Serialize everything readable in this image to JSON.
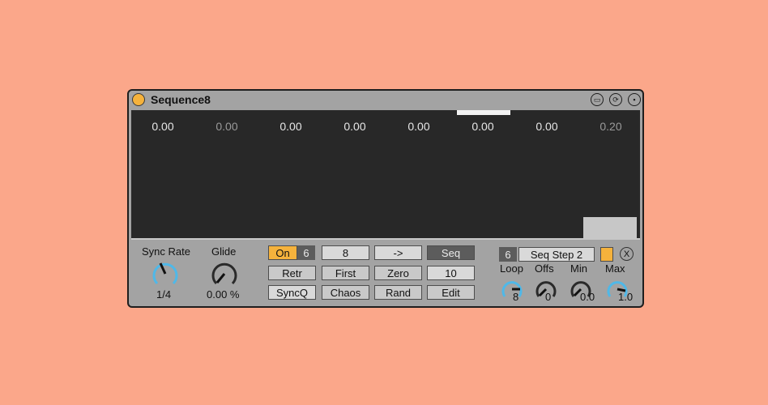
{
  "device": {
    "title": "Sequence8",
    "steps": [
      "0.00",
      "0.00",
      "0.00",
      "0.00",
      "0.00",
      "0.00",
      "0.00",
      "0.20"
    ]
  },
  "left_controls": {
    "sync_rate": {
      "label": "Sync Rate",
      "value": "1/4"
    },
    "glide": {
      "label": "Glide",
      "value": "0.00 %"
    }
  },
  "buttons": {
    "on": "On",
    "on_value": "6",
    "steps_count": "8",
    "arrow": "->",
    "seq": "Seq",
    "retr": "Retr",
    "first": "First",
    "zero": "Zero",
    "num_10": "10",
    "syncq": "SyncQ",
    "chaos": "Chaos",
    "rand": "Rand",
    "edit": "Edit"
  },
  "right_panel": {
    "target_num": "6",
    "target_name": "Seq Step 2",
    "close": "X",
    "loop": {
      "label": "Loop",
      "value": "8"
    },
    "offs": {
      "label": "Offs",
      "value": "0"
    },
    "min": {
      "label": "Min",
      "value": "0.0"
    },
    "max": {
      "label": "Max",
      "value": "1.0"
    }
  },
  "colors": {
    "background": "#fba78a",
    "accent": "#f5b23c",
    "knob_arc": "#4fb8e8",
    "display": "#282828"
  },
  "icons": [
    "power-icon",
    "device-map-icon",
    "hot-swap-icon",
    "save-preset-icon",
    "close-icon"
  ]
}
